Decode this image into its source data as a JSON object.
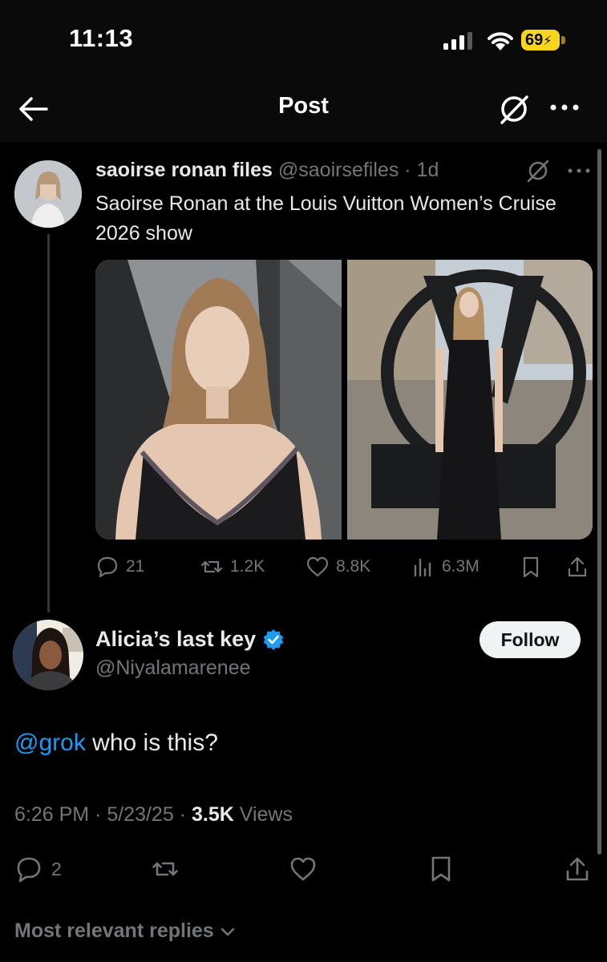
{
  "status_bar": {
    "time": "11:13",
    "battery": "69"
  },
  "header": {
    "title": "Post"
  },
  "post": {
    "name": "saoirse ronan files",
    "handle": "@saoirsefiles",
    "age": "1d",
    "text": "Saoirse Ronan at the Louis Vuitton Women’s Cruise 2026 show",
    "stats": {
      "replies": "21",
      "reposts": "1.2K",
      "likes": "8.8K",
      "views": "6.3M"
    }
  },
  "reply": {
    "name": "Alicia’s last key",
    "handle": "@Niyalamarenee",
    "follow_label": "Follow",
    "mention": "@grok",
    "text": " who is this?",
    "time": "6:26 PM",
    "date": "5/23/25",
    "views_count": "3.5K",
    "views_label": "Views",
    "replies": "2"
  },
  "footer": {
    "sort_label": "Most relevant replies"
  },
  "colors": {
    "accent": "#1d9bf0",
    "muted": "#71767b",
    "text": "#e7e9ea",
    "battery": "#f7d51d"
  }
}
